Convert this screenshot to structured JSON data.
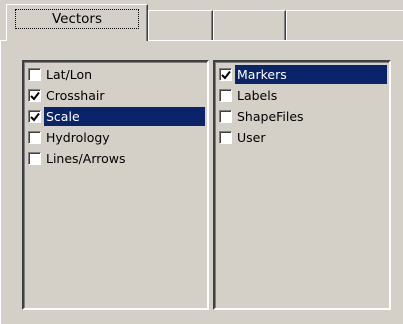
{
  "tabs": [
    {
      "label": "Vectors"
    },
    {
      "label": ""
    },
    {
      "label": ""
    },
    {
      "label": ""
    }
  ],
  "left_list": [
    {
      "label": "Lat/Lon",
      "checked": false,
      "selected": false
    },
    {
      "label": "Crosshair",
      "checked": true,
      "selected": false
    },
    {
      "label": "Scale",
      "checked": true,
      "selected": true
    },
    {
      "label": "Hydrology",
      "checked": false,
      "selected": false
    },
    {
      "label": "Lines/Arrows",
      "checked": false,
      "selected": false
    }
  ],
  "right_list": [
    {
      "label": "Markers",
      "checked": true,
      "selected": true
    },
    {
      "label": "Labels",
      "checked": false,
      "selected": false
    },
    {
      "label": "ShapeFiles",
      "checked": false,
      "selected": false
    },
    {
      "label": "User",
      "checked": false,
      "selected": false
    }
  ],
  "colors": {
    "dialog_bg": "#d4d0c8",
    "selection_bg": "#0a246a",
    "selection_text": "#ffffff"
  }
}
